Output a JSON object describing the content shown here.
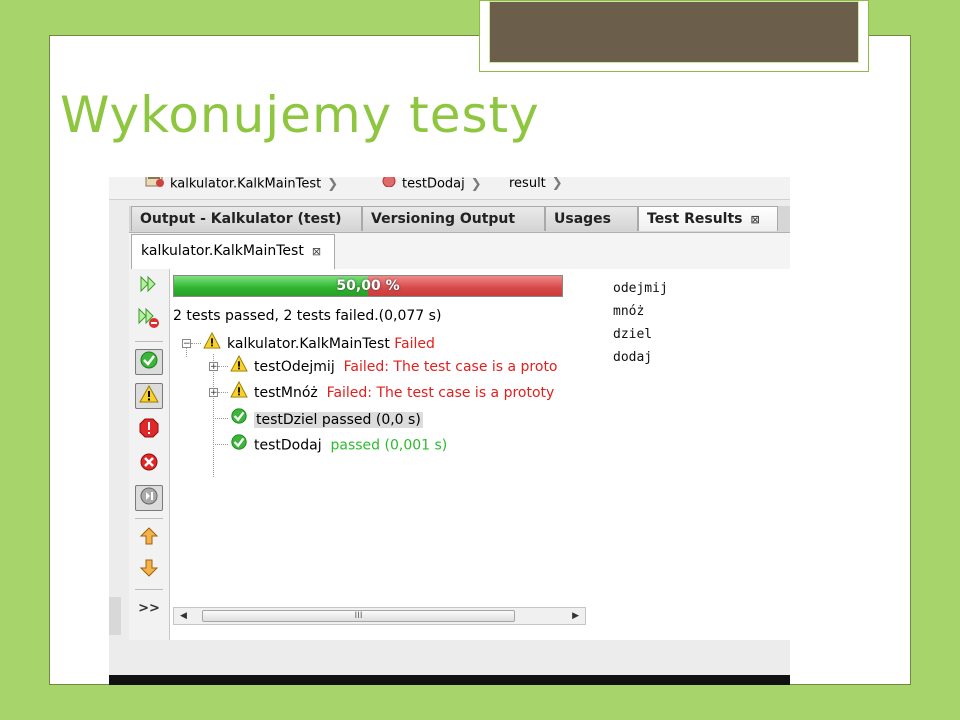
{
  "slide": {
    "title": "Wykonujemy testy",
    "colors": {
      "background": "#a8d56b",
      "title": "#8ec63f",
      "frame": "#ffffff"
    }
  },
  "breadcrumb": {
    "items": [
      {
        "label": "kalkulator.KalkMainTest",
        "icon": "test-class-icon"
      },
      {
        "label": "testDodaj",
        "icon": "method-icon"
      },
      {
        "label": "result",
        "icon": ""
      }
    ]
  },
  "output_tabs": [
    {
      "label": "Output - Kalkulator (test)",
      "closable": false
    },
    {
      "label": "Versioning Output",
      "closable": false
    },
    {
      "label": "Usages",
      "closable": false
    },
    {
      "label": "Test Results",
      "closable": true,
      "active": true
    }
  ],
  "close_glyph": "⊠",
  "sub_tab": {
    "label": "kalkulator.KalkMainTest",
    "close": "⊠"
  },
  "progress": {
    "label": "50,00 %",
    "pass_fraction": 0.5,
    "colors": {
      "pass": "#2fb32f",
      "fail": "#d84848"
    }
  },
  "summary": "2 tests passed, 2 tests failed.(0,077 s)",
  "tree": {
    "suite": {
      "name": "kalkulator.KalkMainTest",
      "status": "Failed"
    },
    "tests": [
      {
        "name": "testOdejmij",
        "status": "Failed: The test case is a proto",
        "result": "fail"
      },
      {
        "name": "testMnóż",
        "status": "Failed: The test case is a prototy",
        "result": "fail"
      },
      {
        "name": "testDziel passed  (0,0 s)",
        "status": "",
        "result": "pass",
        "selected": true
      },
      {
        "name": "testDodaj",
        "status": "passed  (0,001 s)",
        "result": "pass"
      }
    ]
  },
  "toolbar": {
    "more": ">>",
    "buttons": [
      "rerun-icon",
      "rerun-failed-icon",
      "show-passed-icon",
      "show-failed-icon",
      "show-error-icon",
      "show-aborted-icon",
      "show-skipped-icon",
      "previous-failure-icon",
      "next-failure-icon"
    ]
  },
  "scrollbar": {
    "thumb_label": "III"
  },
  "output_lines": [
    "odejmij",
    "mnóż",
    "dziel",
    "dodaj"
  ]
}
